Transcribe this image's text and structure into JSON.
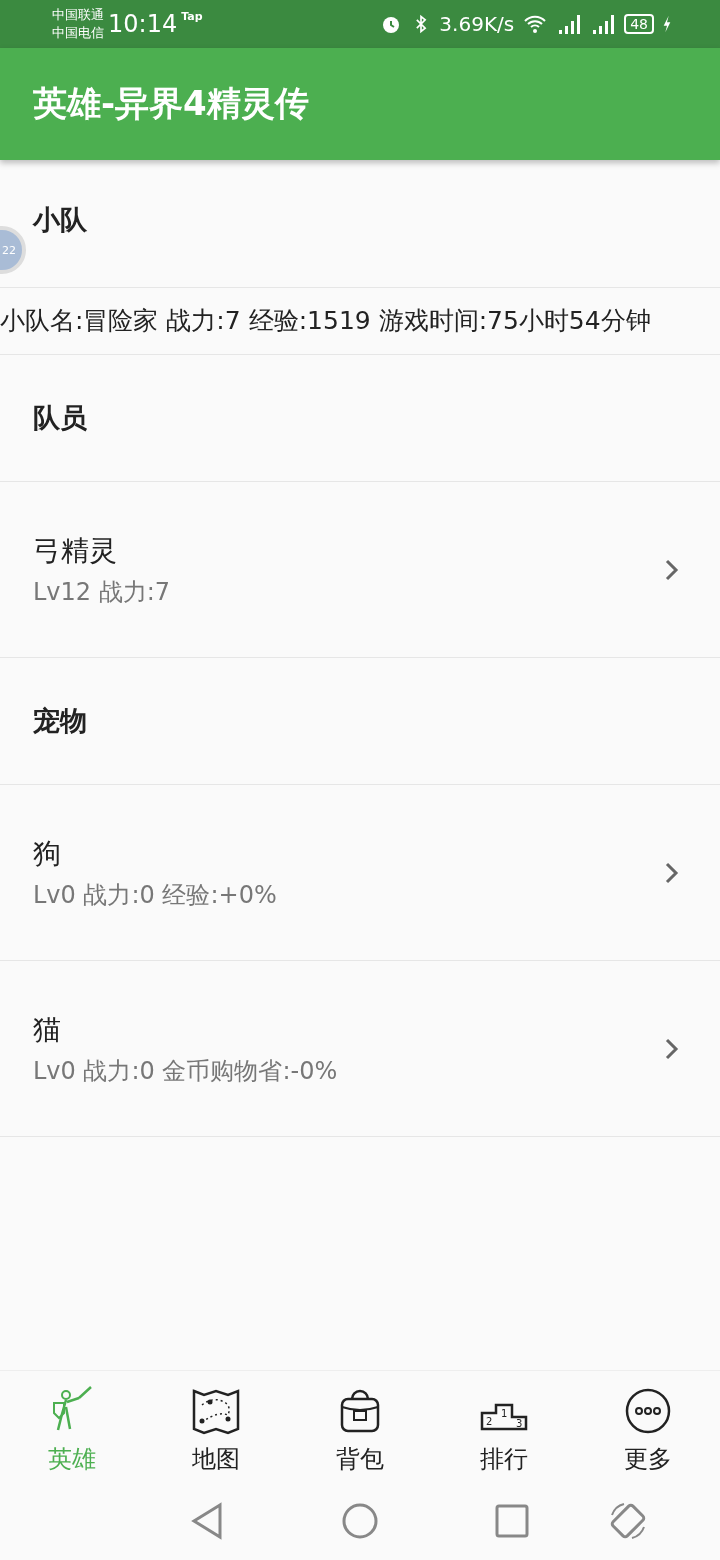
{
  "status_bar": {
    "carriers": [
      "中国联通",
      "中国电信"
    ],
    "time": "10:14",
    "tag": "Tap",
    "speed": "3.69K/s",
    "battery": "48"
  },
  "app_bar": {
    "title": "英雄-异界4精灵传"
  },
  "floating_ball": {
    "label": "22"
  },
  "team": {
    "heading": "小队",
    "info": "小队名:冒险家  战力:7  经验:1519  游戏时间:75小时54分钟"
  },
  "members": {
    "heading": "队员",
    "items": [
      {
        "name": "弓精灵",
        "detail": "Lv12 战力:7"
      }
    ]
  },
  "pets": {
    "heading": "宠物",
    "items": [
      {
        "name": "狗",
        "detail": "Lv0 战力:0 经验:+0%"
      },
      {
        "name": "猫",
        "detail": "Lv0 战力:0 金币购物省:-0%"
      }
    ]
  },
  "bottom_nav": [
    {
      "label": "英雄",
      "kind": "hero",
      "selected": true
    },
    {
      "label": "地图",
      "kind": "map",
      "selected": false
    },
    {
      "label": "背包",
      "kind": "bag",
      "selected": false
    },
    {
      "label": "排行",
      "kind": "rank",
      "selected": false,
      "icon_marks": [
        "2",
        "1",
        "3"
      ]
    },
    {
      "label": "更多",
      "kind": "more",
      "selected": false
    }
  ]
}
